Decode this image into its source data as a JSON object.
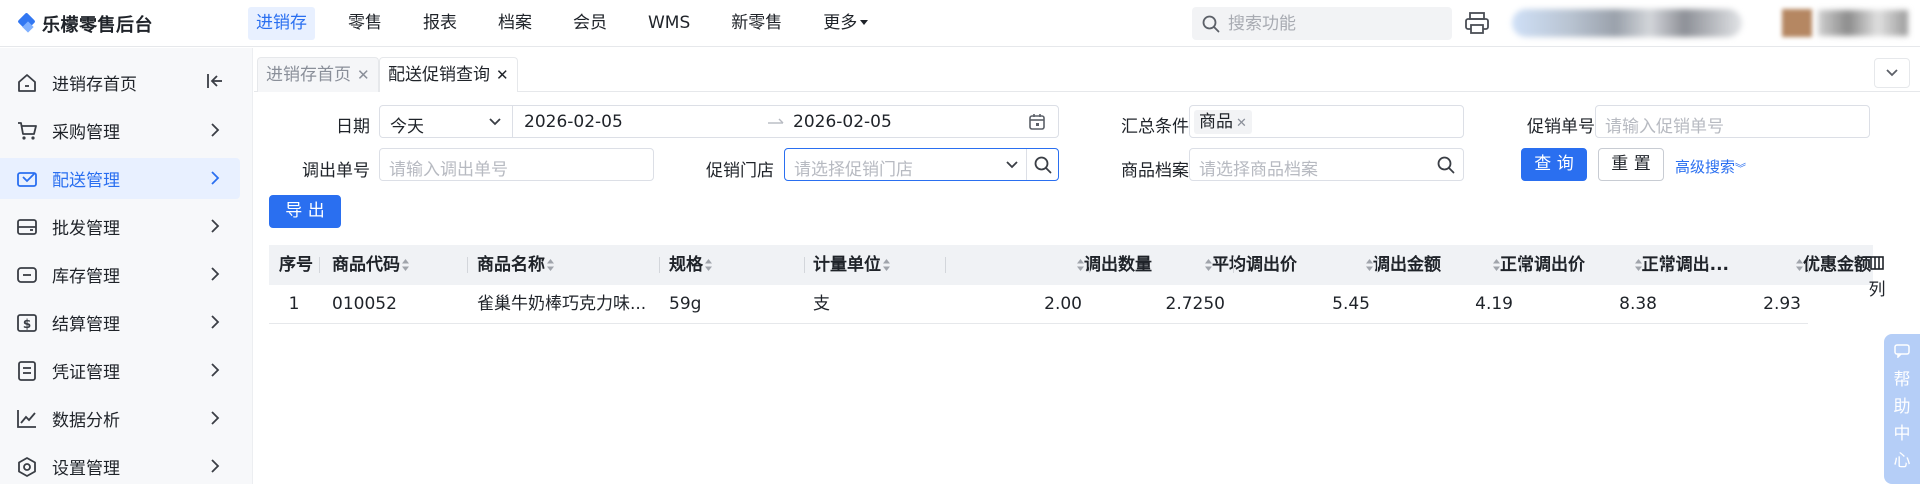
{
  "app": {
    "name": "乐檬零售后台"
  },
  "nav": {
    "items": [
      "进销存",
      "零售",
      "报表",
      "档案",
      "会员",
      "WMS",
      "新零售"
    ],
    "more": "更多",
    "active_index": 0
  },
  "search": {
    "placeholder": "搜索功能"
  },
  "sidebar": {
    "items": [
      {
        "label": "进销存首页",
        "icon": "home-icon"
      },
      {
        "label": "采购管理",
        "icon": "cart-icon"
      },
      {
        "label": "配送管理",
        "icon": "delivery-icon"
      },
      {
        "label": "批发管理",
        "icon": "wholesale-icon"
      },
      {
        "label": "库存管理",
        "icon": "inventory-icon"
      },
      {
        "label": "结算管理",
        "icon": "settlement-icon"
      },
      {
        "label": "凭证管理",
        "icon": "voucher-icon"
      },
      {
        "label": "数据分析",
        "icon": "chart-icon"
      },
      {
        "label": "设置管理",
        "icon": "settings-icon"
      }
    ],
    "active_index": 2
  },
  "tabs": [
    {
      "label": "进销存首页",
      "active": false
    },
    {
      "label": "配送促销查询",
      "active": true
    }
  ],
  "filters": {
    "date_label": "日期",
    "date_preset": "今天",
    "date_start": "2026-02-05",
    "date_end": "2026-02-05",
    "summary_label": "汇总条件",
    "summary_tag": "商品",
    "promo_no_label": "促销单号",
    "promo_no_placeholder": "请输入促销单号",
    "transfer_no_label": "调出单号",
    "transfer_no_placeholder": "请输入调出单号",
    "promo_store_label": "促销门店",
    "promo_store_placeholder": "请选择促销门店",
    "product_label": "商品档案",
    "product_placeholder": "请选择商品档案",
    "query_button": "查 询",
    "reset_button": "重 置",
    "advanced_search": "高级搜索"
  },
  "export_button": "导 出",
  "table": {
    "columns": [
      "序号",
      "商品代码",
      "商品名称",
      "规格",
      "计量单位",
      "调出数量",
      "平均调出价",
      "调出金额",
      "正常调出价",
      "正常调出...",
      "优惠金额"
    ],
    "rows": [
      [
        "1",
        "010052",
        "雀巢牛奶棒巧克力味...",
        "59g",
        "支",
        "2.00",
        "2.7250",
        "5.45",
        "4.19",
        "8.38",
        "2.93"
      ]
    ]
  },
  "column_setting": "列",
  "help": {
    "label": "帮助中心"
  }
}
